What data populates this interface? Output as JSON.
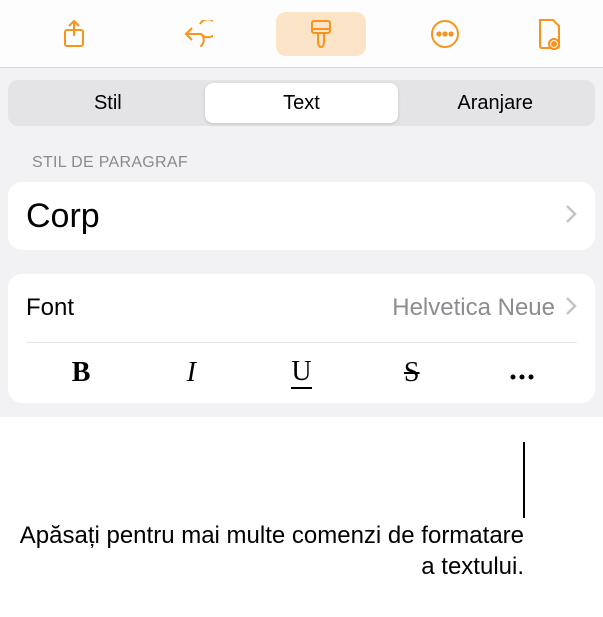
{
  "toolbar": {
    "share_icon": "share-icon",
    "undo_icon": "undo-icon",
    "format_icon": "brush-icon",
    "more_icon": "ellipsis-icon",
    "document_icon": "document-view-icon"
  },
  "tabs": {
    "style": "Stil",
    "text": "Text",
    "arrange": "Aranjare"
  },
  "paragraph": {
    "header": "STIL DE PARAGRAF",
    "value": "Corp"
  },
  "font": {
    "label": "Font",
    "value": "Helvetica Neue"
  },
  "format_buttons": {
    "bold": "B",
    "italic": "I",
    "underline": "U",
    "strike": "S"
  },
  "callout": "Apăsați pentru mai multe comenzi de formatare a textului."
}
